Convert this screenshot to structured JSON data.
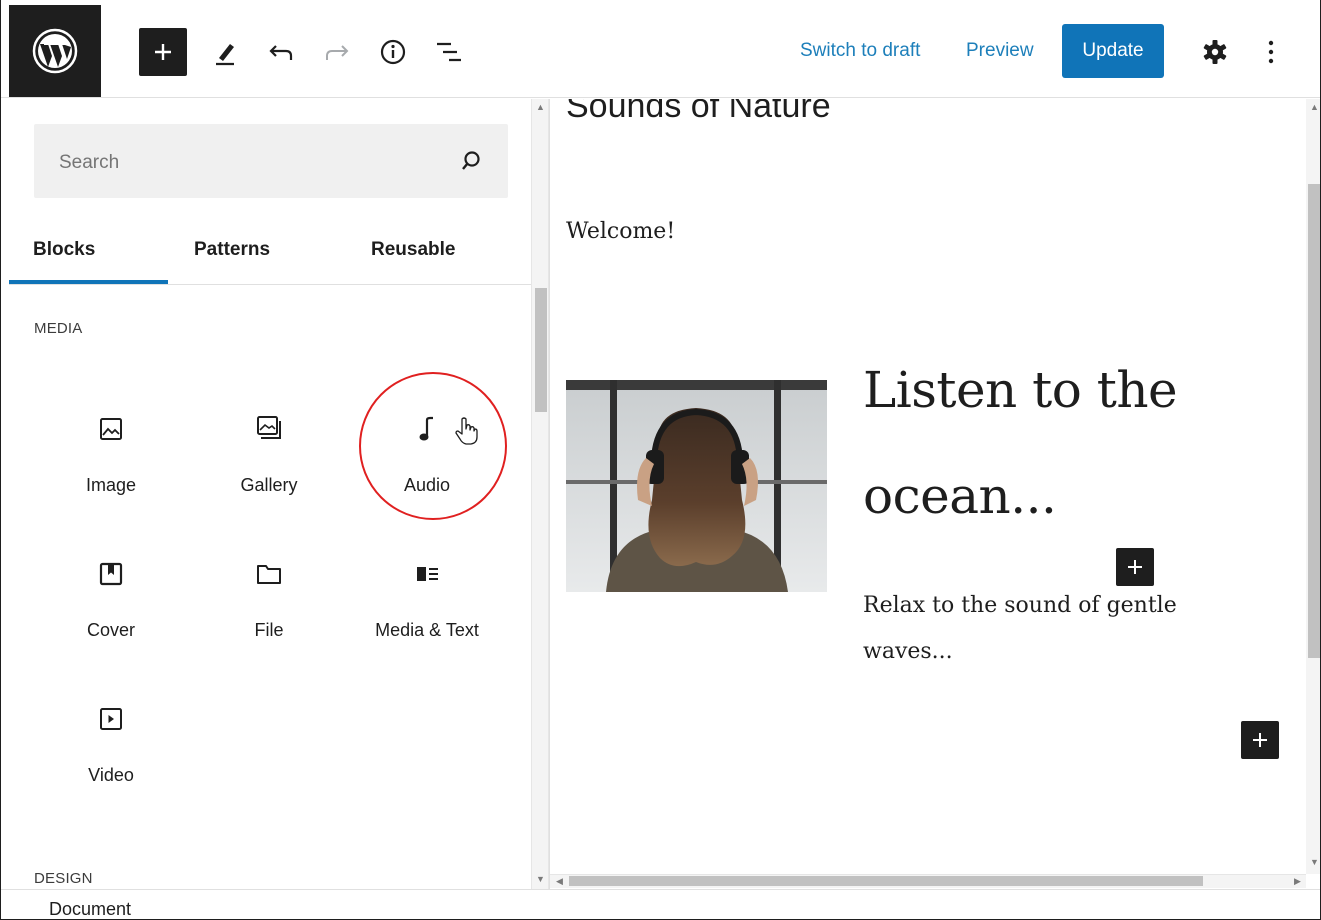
{
  "toolbar": {
    "add_block_label": "Add block",
    "switch_to_draft": "Switch to draft",
    "preview": "Preview",
    "update": "Update"
  },
  "inserter": {
    "search_placeholder": "Search",
    "tabs": [
      {
        "label": "Blocks",
        "active": true
      },
      {
        "label": "Patterns",
        "active": false
      },
      {
        "label": "Reusable",
        "active": false
      }
    ],
    "sections": {
      "media": "MEDIA",
      "design": "DESIGN"
    },
    "blocks": [
      {
        "label": "Image",
        "icon": "image-icon"
      },
      {
        "label": "Gallery",
        "icon": "gallery-icon"
      },
      {
        "label": "Audio",
        "icon": "audio-icon",
        "highlighted": true
      },
      {
        "label": "Cover",
        "icon": "cover-icon"
      },
      {
        "label": "File",
        "icon": "file-icon"
      },
      {
        "label": "Media & Text",
        "icon": "media-text-icon"
      },
      {
        "label": "Video",
        "icon": "video-icon"
      }
    ]
  },
  "canvas": {
    "post_title": "Sounds of Nature",
    "welcome": "Welcome!",
    "heading_line1": "Listen to the",
    "heading_line2": "ocean...",
    "body_line1": "Relax to the sound of gentle",
    "body_line2": "waves..."
  },
  "footer": {
    "breadcrumb": "Document"
  },
  "colors": {
    "accent": "#1074b8",
    "link": "#1d7fba",
    "dark": "#1e1e1e",
    "highlight_circle": "#e02020"
  }
}
